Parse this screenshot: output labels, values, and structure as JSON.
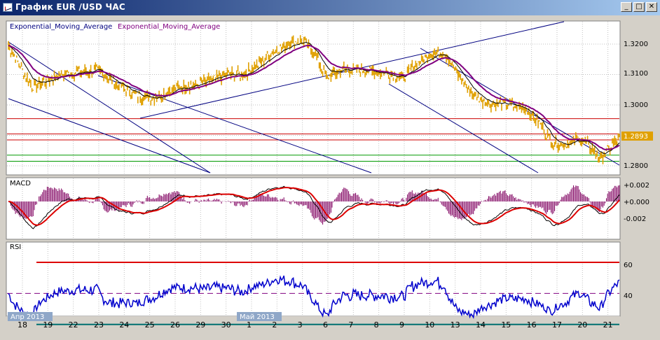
{
  "window": {
    "title": "График EUR /USD  ЧАС",
    "buttons": [
      {
        "name": "minimize-button",
        "glyph": "_"
      },
      {
        "name": "maximize-button",
        "glyph": "□"
      },
      {
        "name": "close-button",
        "glyph": "✕"
      }
    ]
  },
  "indicators": {
    "ema_label_1": "Exponential_Moving_Average",
    "ema_label_2": "Exponential_Moving_Average",
    "macd_label": "MACD",
    "rsi_label": "RSI"
  },
  "price_axis": {
    "ticks": [
      "1.3200",
      "1.3100",
      "1.3000",
      "1.2900",
      "1.2800"
    ],
    "tick_values": [
      1.32,
      1.31,
      1.3,
      1.29,
      1.28
    ],
    "current_price": "1.2893",
    "current_value": 1.2893
  },
  "macd_axis": {
    "ticks": [
      "+0.002",
      "+0.000",
      "-0.002"
    ],
    "tick_values": [
      0.002,
      0.0,
      -0.002
    ]
  },
  "rsi_axis": {
    "ticks": [
      "60",
      "40"
    ],
    "tick_values": [
      60,
      40
    ],
    "upper_level": 70,
    "mid_level": 50,
    "lower_level": 30
  },
  "time_axis": {
    "labels": [
      "18",
      "19",
      "22",
      "23",
      "24",
      "25",
      "26",
      "29",
      "30",
      "1",
      "2",
      "3",
      "6",
      "7",
      "8",
      "9",
      "10",
      "13",
      "14",
      "15",
      "16",
      "17",
      "20",
      "21"
    ],
    "month_tags": [
      {
        "label": "Апр 2013",
        "at_label": "18"
      },
      {
        "label": "Май 2013",
        "at_label": "1"
      }
    ]
  },
  "horizontal_levels": {
    "red_prices": [
      1.2955,
      1.2905,
      1.2885
    ],
    "green_prices": [
      1.2835,
      1.2815
    ]
  },
  "colors": {
    "price_bars": "#e0a000",
    "ema_fast": "#000000",
    "ema_slow": "#800080",
    "trendline": "#000080",
    "level_red": "#cc0000",
    "level_green": "#009900",
    "macd_signal": "#dd0000",
    "macd_hist": "#800060",
    "rsi_line": "#0000cc",
    "rsi_upper": "#dd0000",
    "rsi_mid": "#800080",
    "rsi_lower": "#007070"
  }
}
